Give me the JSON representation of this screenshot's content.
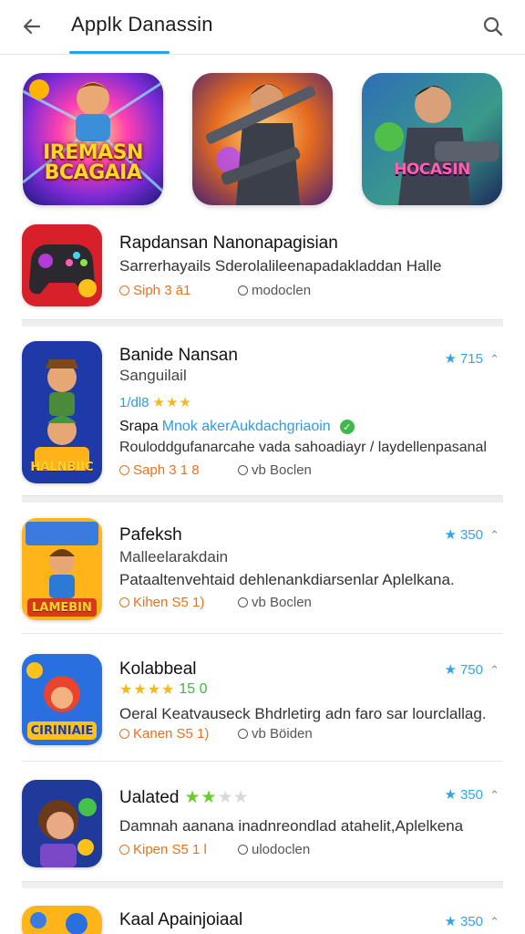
{
  "header": {
    "title": "Applk Danassin",
    "back_icon": "back-arrow-icon",
    "search_icon": "search-icon",
    "accent": "#2aa0e6"
  },
  "featured": [
    {
      "caption": "IREMASN BCAGAIA"
    },
    {
      "caption": ""
    },
    {
      "caption": "HOCASIN"
    }
  ],
  "apps": [
    {
      "name": "Rapdansan Nanonapagisian",
      "description": "Sarrerhayails Sderolalileenapadakladdan Halle",
      "meta_left": "Siph 3 ā1",
      "meta_right": "modoclen"
    },
    {
      "name": "Banide Nansan",
      "subtitle": "Sanguilail",
      "rating_inline": "1/dl8",
      "badge_prefix": "Srapa",
      "badge_text": "Mnok akerAukdachgriaoin",
      "description": "Rouloddgufanarcahe vada sahoadiayr / laydellenpasanal",
      "meta_left": "Saph 3 1 8",
      "meta_right": "vb Boclen",
      "rating": "715",
      "icon_caption": "HALNBIIC"
    },
    {
      "name": "Pafeksh",
      "subtitle": "Malleelarakdain",
      "description": "Pataaltenvehtaid dehlenankdiarsenlar Aplelkana.",
      "meta_left": "Kihen S5 1)",
      "meta_right": "vb Boclen",
      "rating": "350",
      "icon_caption": "LAMEBIN"
    },
    {
      "name": "Kolabbeal",
      "rating_inline": "15 0",
      "description": "Oeral Keatvauseck Bhdrletirg adn faro sar lourclallag.",
      "meta_left": "Kanen S5 1)",
      "meta_right": "vb Böiden",
      "rating": "750",
      "icon_caption": "CIRINIAIE"
    },
    {
      "name": "Ualated",
      "description": "Damnah aanana inadnreondlad atahelit,Aplelkena",
      "meta_left": "Kipen S5 1 l",
      "meta_right": "ulodoclen",
      "rating": "350"
    },
    {
      "name": "Kaal Apainjoiaal",
      "rating": "350"
    }
  ]
}
